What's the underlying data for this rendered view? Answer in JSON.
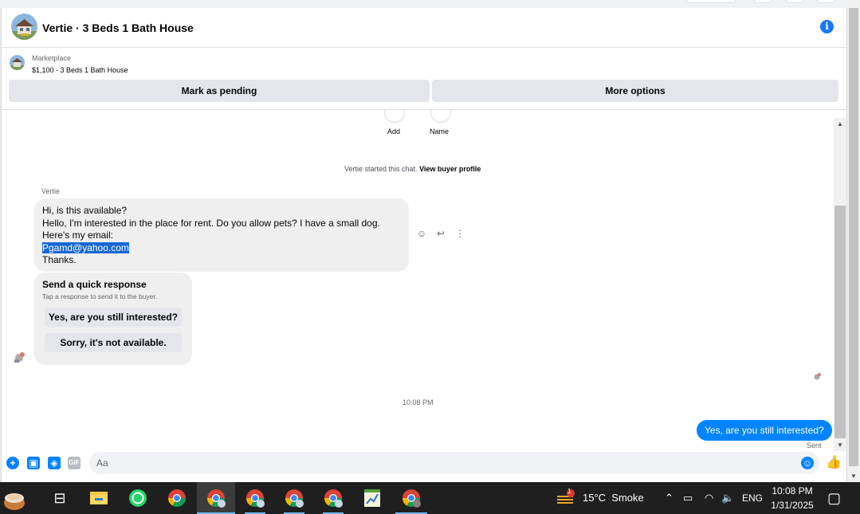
{
  "header": {
    "title": "Vertie · 3 Beds 1 Bath House"
  },
  "listing": {
    "category": "Marketplace",
    "price_title": "$1,100 - 3 Beds 1 Bath House",
    "mark_pending_label": "Mark as pending",
    "more_options_label": "More options"
  },
  "profile_actions": [
    {
      "label": "Add"
    },
    {
      "label": "Name"
    }
  ],
  "chat": {
    "started_text": "Vertie started this chat.",
    "view_profile_label": "View buyer profile",
    "sender_name": "Vertie",
    "message_lines": [
      "Hi, is this available?",
      "Hello, I'm interested in the place for rent. Do you allow pets? I have a small dog.",
      "Here's my email:"
    ],
    "email": "Pgamd@yahoo.com",
    "closing": "Thanks.",
    "quick_response": {
      "title": "Send a quick response",
      "subtitle": "Tap a response to send it to the buyer.",
      "option_yes": "Yes, are you still interested?",
      "option_no": "Sorry, it's not available."
    },
    "timestamp": "10:08 PM",
    "outgoing_message": "Yes, are you still interested?",
    "status": "Sent"
  },
  "composer": {
    "placeholder": "Aa"
  },
  "taskbar": {
    "weather_badge": "1",
    "weather": "15°C  Smoke",
    "language": "ENG",
    "time": "10:08 PM",
    "date": "1/31/2025"
  },
  "colors": {
    "accent": "#0084ff",
    "brand_blue": "#1877f2",
    "bubble_gray": "#efefef",
    "button_gray": "#e4e6eb"
  }
}
